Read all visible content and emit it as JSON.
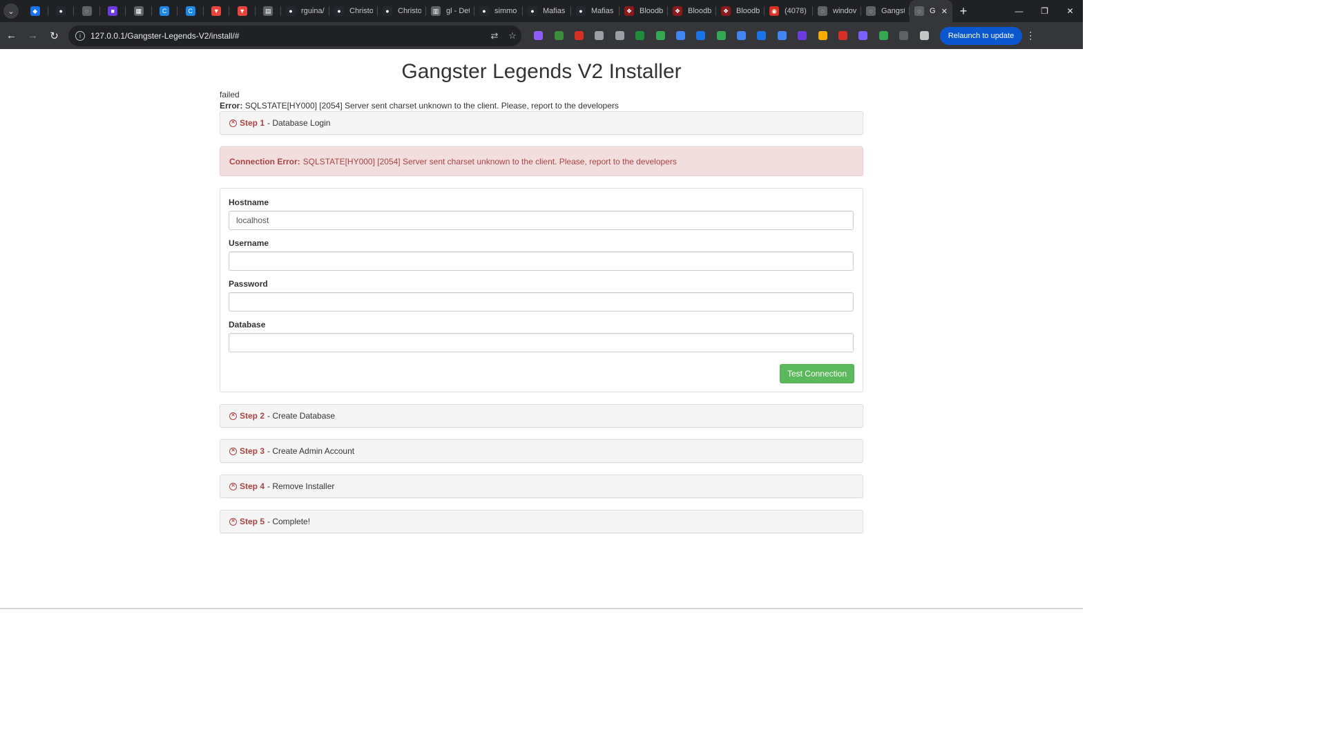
{
  "browser": {
    "tabs": [
      {
        "title": "",
        "fav_color": "#1a73e8",
        "fav": "diamond-icon"
      },
      {
        "title": "",
        "fav_color": "#24292f",
        "fav": "github-icon"
      },
      {
        "title": "",
        "fav_color": "#5f6368",
        "fav": "globe-icon"
      },
      {
        "title": "",
        "fav_color": "#6c3ce0",
        "fav": "app-icon"
      },
      {
        "title": "",
        "fav_color": "#5f6368",
        "fav": "grid-icon"
      },
      {
        "title": "",
        "fav_color": "#1e88e5",
        "fav": "c-icon"
      },
      {
        "title": "",
        "fav_color": "#1e88e5",
        "fav": "c-icon"
      },
      {
        "title": "",
        "fav_color": "#e8453c",
        "fav": "pocket-icon"
      },
      {
        "title": "",
        "fav_color": "#e8453c",
        "fav": "pocket-icon"
      },
      {
        "title": "",
        "fav_color": "#5f6368",
        "fav": "file-icon"
      },
      {
        "title": "rguina/",
        "fav_color": "#24292f",
        "fav": "github-icon"
      },
      {
        "title": "Christo",
        "fav_color": "#24292f",
        "fav": "github-icon"
      },
      {
        "title": "Christo",
        "fav_color": "#24292f",
        "fav": "github-icon"
      },
      {
        "title": "gl - Det",
        "fav_color": "#5f6368",
        "fav": "chart-icon"
      },
      {
        "title": "simmo",
        "fav_color": "#24292f",
        "fav": "github-icon"
      },
      {
        "title": "Mafias",
        "fav_color": "#24292f",
        "fav": "github-icon"
      },
      {
        "title": "Mafias",
        "fav_color": "#24292f",
        "fav": "github-icon"
      },
      {
        "title": "Bloodb",
        "fav_color": "#8b1a1a",
        "fav": "blood-icon"
      },
      {
        "title": "Bloodb",
        "fav_color": "#8b1a1a",
        "fav": "blood-icon"
      },
      {
        "title": "Bloodb",
        "fav_color": "#8b1a1a",
        "fav": "blood-icon"
      },
      {
        "title": "(4078)",
        "fav_color": "#d93025",
        "fav": "chat-icon"
      },
      {
        "title": "windov",
        "fav_color": "#5f6368",
        "fav": "globe-icon"
      },
      {
        "title": "Gangst",
        "fav_color": "#5f6368",
        "fav": "globe-icon"
      }
    ],
    "active_tab": {
      "title": "Ga",
      "fav": "globe-icon"
    },
    "url": "127.0.0.1/Gangster-Legends-V2/install/#",
    "relaunch_label": "Relaunch to update",
    "extensions": [
      "#8e5cf7",
      "#3c8d3c",
      "#d93025",
      "#9aa0a6",
      "#9aa0a6",
      "#1e8e3e",
      "#34a853",
      "#4285f4",
      "#1a73e8",
      "#34a853",
      "#4285f4",
      "#1a73e8",
      "#4285f4",
      "#6c3ce0",
      "#f9ab00",
      "#d93025",
      "#7b61ff",
      "#34a853",
      "#5f6368",
      "#c4c7c5"
    ]
  },
  "page": {
    "title": "Gangster Legends V2 Installer",
    "status_text": "failed",
    "error_label": "Error:",
    "error_text": "SQLSTATE[HY000] [2054] Server sent charset unknown to the client. Please, report to the developers",
    "alert_label": "Connection Error:",
    "alert_text": "SQLSTATE[HY000] [2054] Server sent charset unknown to the client. Please, report to the developers",
    "steps": [
      {
        "step": "Step 1",
        "name": "- Database Login"
      },
      {
        "step": "Step 2",
        "name": "- Create Database"
      },
      {
        "step": "Step 3",
        "name": "- Create Admin Account"
      },
      {
        "step": "Step 4",
        "name": "- Remove Installer"
      },
      {
        "step": "Step 5",
        "name": "- Complete!"
      }
    ],
    "form": {
      "hostname_label": "Hostname",
      "hostname_value": "localhost",
      "username_label": "Username",
      "username_value": "",
      "password_label": "Password",
      "password_value": "",
      "database_label": "Database",
      "database_value": "",
      "submit_label": "Test Connection"
    },
    "colors": {
      "danger": "#a94442",
      "alert_bg": "#f2dede",
      "success": "#5cb85c"
    }
  }
}
